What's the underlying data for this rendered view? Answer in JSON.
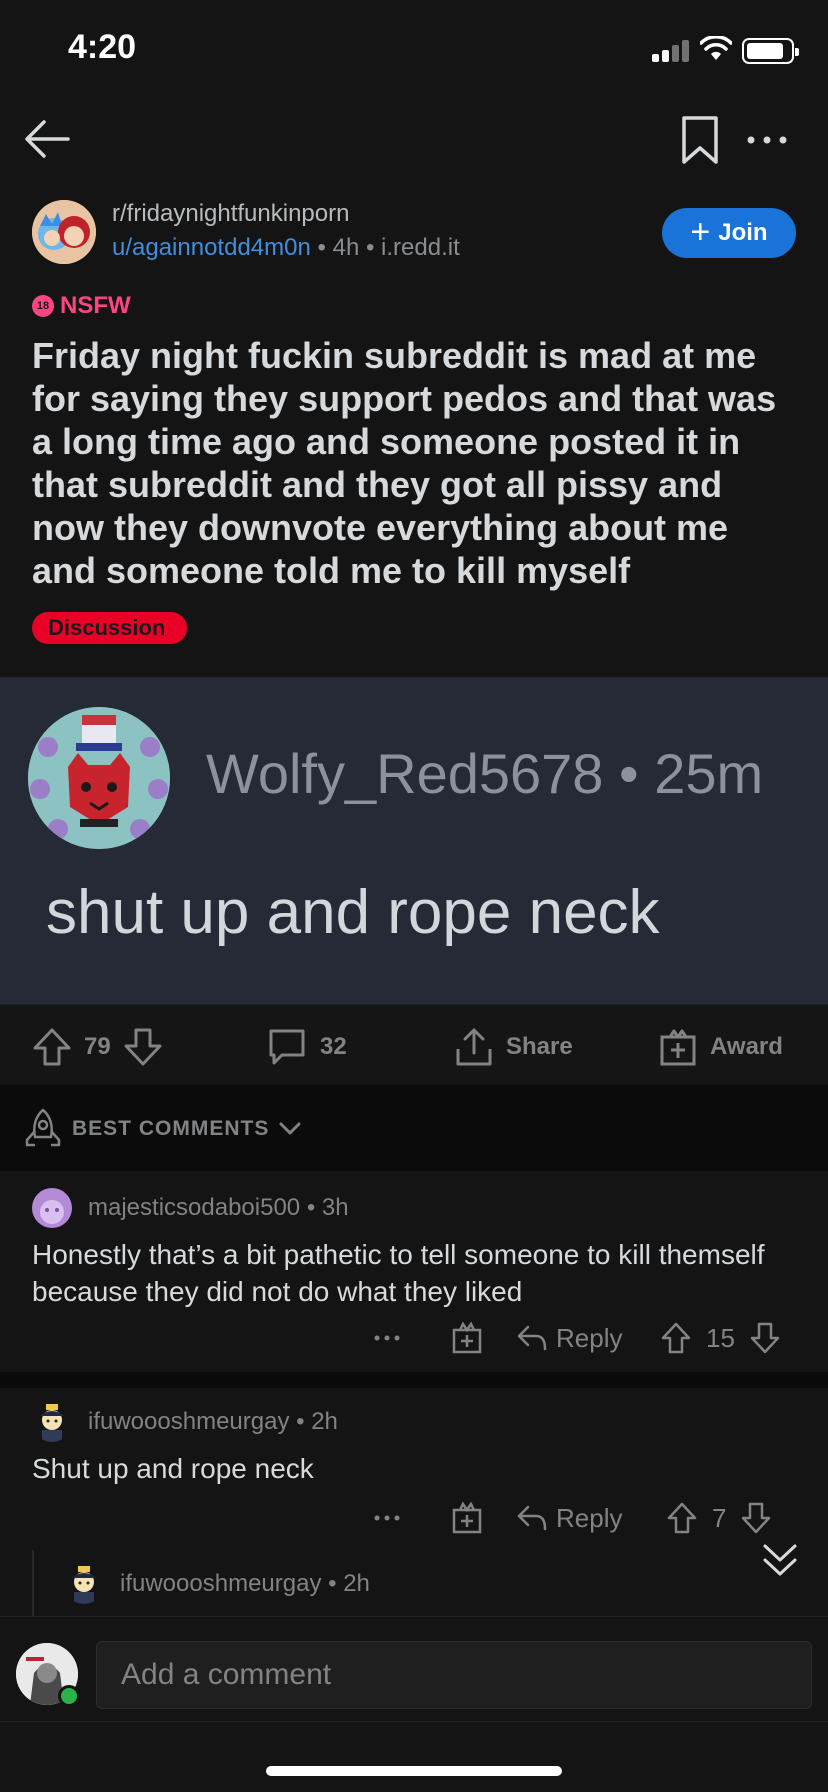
{
  "status_bar": {
    "time": "4:20"
  },
  "post": {
    "subreddit": "r/fridaynightfunkinporn",
    "author": "u/againnotdd4m0n",
    "age": "4h",
    "domain": "i.redd.it",
    "join_label": "Join",
    "nsfw_label": "NSFW",
    "nsfw_badge": "18",
    "title": "Friday night fuckin subreddit is mad at me for saying they support pedos and that was a long time ago and someone posted it in that subreddit and they got all pissy and now they downvote everything about me and someone told me to kill myself",
    "flair": "Discussion"
  },
  "image": {
    "username": "Wolfy_Red5678",
    "age": "25m",
    "comment": "shut up and rope neck"
  },
  "actions": {
    "votes": "79",
    "comments": "32",
    "share_label": "Share",
    "award_label": "Award"
  },
  "sort": {
    "label": "BEST COMMENTS"
  },
  "comments": [
    {
      "user": "majesticsodaboi500",
      "age": "3h",
      "body": "Honestly that’s a bit pathetic to tell someone to kill themself because they did not do what they liked",
      "reply_label": "Reply",
      "votes": "15"
    },
    {
      "user": "ifuwoooshmeurgay",
      "age": "2h",
      "body": "Shut up and rope neck",
      "reply_label": "Reply",
      "votes": "7"
    },
    {
      "user": "ifuwoooshmeurgay",
      "age": "2h"
    }
  ],
  "composer": {
    "placeholder": "Add a comment"
  },
  "icons": [
    "back-arrow-icon",
    "bookmark-icon",
    "more-icon",
    "upvote-icon",
    "downvote-icon",
    "comment-icon",
    "share-icon",
    "award-icon",
    "rocket-icon",
    "chevron-down-icon",
    "reply-icon",
    "collapse-icon"
  ],
  "colors": {
    "background": "#141414",
    "accent": "#1a73d9",
    "nsfw": "#ff4581",
    "flair": "#ea0027",
    "link": "#3f8fe0"
  }
}
